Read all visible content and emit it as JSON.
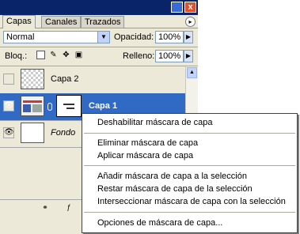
{
  "tabs": [
    {
      "label": "Capas",
      "active": true
    },
    {
      "label": "Canales",
      "active": false
    },
    {
      "label": "Trazados",
      "active": false
    }
  ],
  "title_close": "x",
  "blend": {
    "value": "Normal"
  },
  "opacity": {
    "label": "Opacidad:",
    "value": "100%"
  },
  "lock": {
    "label": "Bloq.:"
  },
  "fill": {
    "label": "Relleno:",
    "value": "100%"
  },
  "layers": [
    {
      "name": "Capa 2",
      "visible": false,
      "selected": false
    },
    {
      "name": "Capa 1",
      "visible": true,
      "selected": true,
      "has_mask": true
    },
    {
      "name": "Fondo",
      "visible": true,
      "selected": false
    }
  ],
  "context_menu": {
    "items": [
      "Deshabilitar máscara de capa",
      "Eliminar máscara de capa",
      "Aplicar máscara de capa",
      "Añadir máscara de capa a la selección",
      "Restar máscara de capa de la selección",
      "Interseccionar máscara de capa con la selección",
      "Opciones de máscara de capa..."
    ]
  },
  "colors": {
    "selection": "#316ac5",
    "titlebar": "#0a246a"
  }
}
